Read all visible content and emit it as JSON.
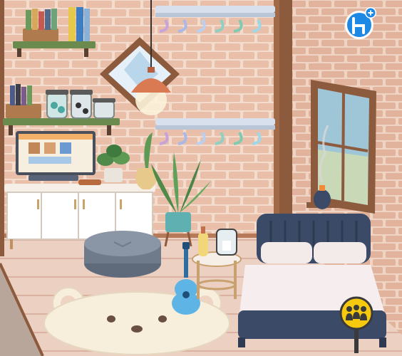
{
  "game": {
    "scene": "bedroom",
    "hud": {
      "furniture_button": {
        "icon": "chair-add-icon",
        "color": "#1e88e5"
      },
      "family_button": {
        "icon": "family-icon",
        "color": "#f6c90e"
      }
    },
    "colors": {
      "brick_light": "#f1d7c6",
      "brick_dark": "#e5b9a4",
      "floor": "#e8c7b8",
      "wood_trim": "#8c5a3c",
      "bed": "#3b4a66",
      "rug": "#f7eedc"
    },
    "objects": [
      "shelf-with-books",
      "shelf-with-jars",
      "window-diamond",
      "pendant-lamp",
      "hanger-rack-top",
      "hanger-rack-bottom",
      "computer-monitor",
      "dresser",
      "potted-plant-small",
      "vase-leaf",
      "floor-plant",
      "pouf",
      "guitar",
      "side-table",
      "bed",
      "bear-rug",
      "window-right",
      "incense-burner"
    ]
  }
}
